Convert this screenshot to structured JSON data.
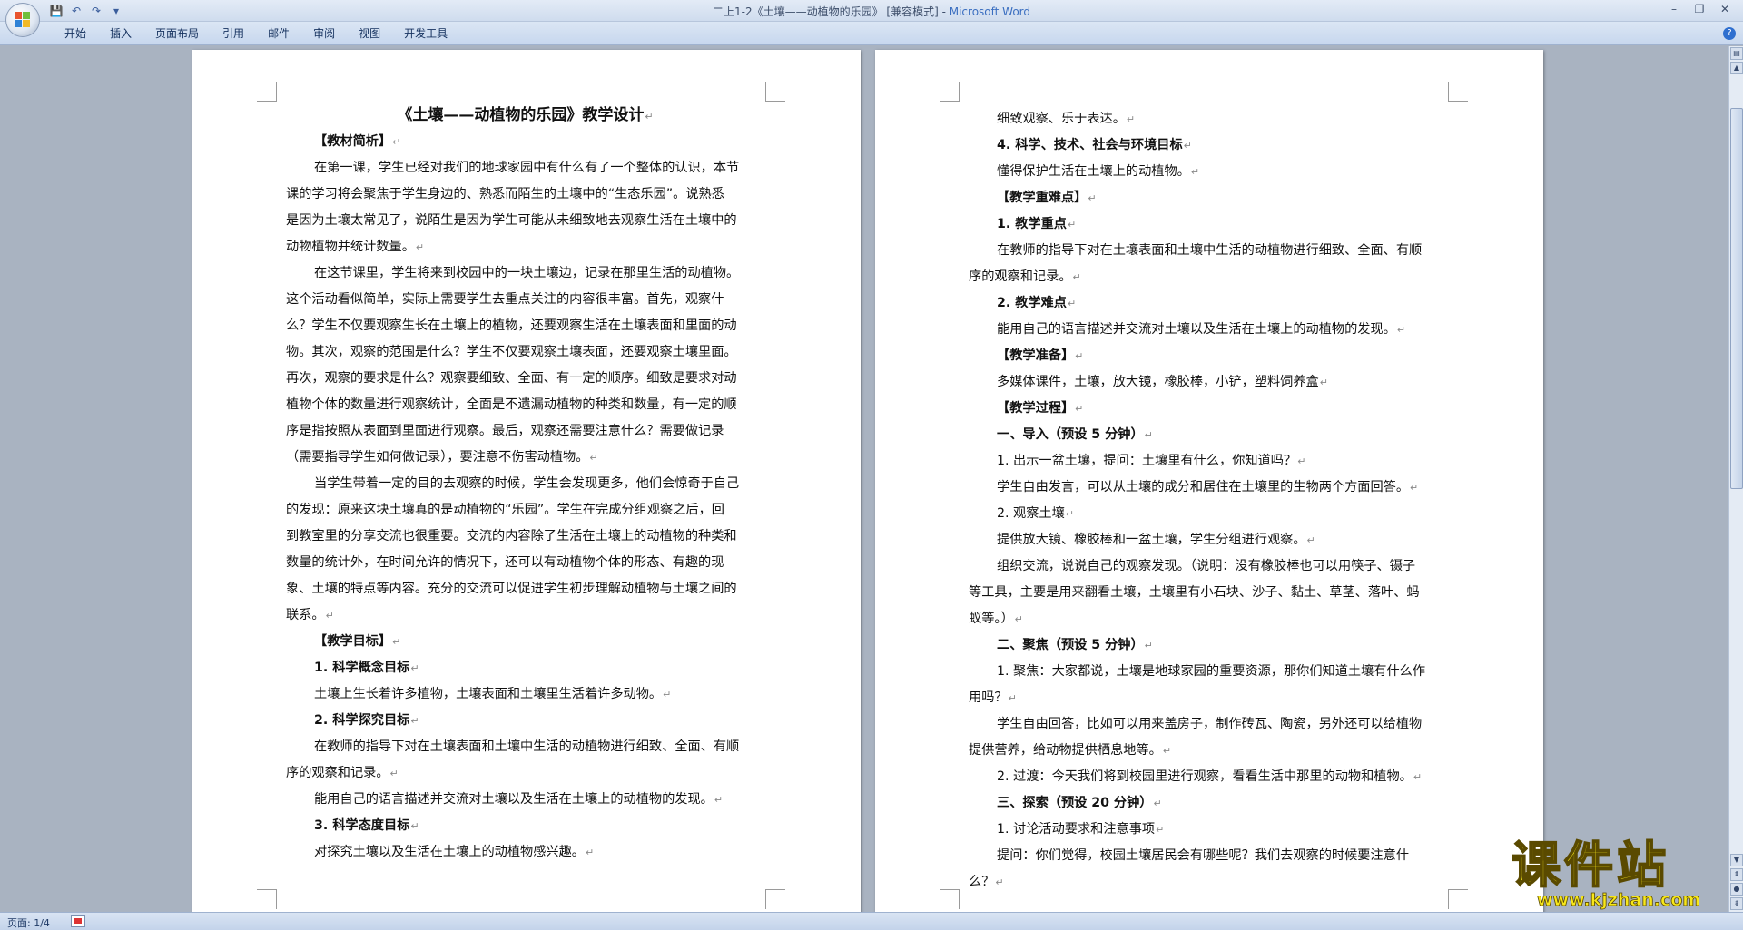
{
  "window": {
    "title": "二上1-2《土壤——动植物的乐园》 [兼容模式] - ",
    "app_name": "Microsoft Word"
  },
  "quick_access": {
    "save": "💾",
    "undo": "↶",
    "redo": "↷",
    "customize": "▾"
  },
  "ribbon_tabs": [
    "开始",
    "插入",
    "页面布局",
    "引用",
    "邮件",
    "审阅",
    "视图",
    "开发工具"
  ],
  "page1": {
    "title": "《土壤——动植物的乐园》教学设计",
    "lines": [
      {
        "text": "【教材简析】",
        "bold": true,
        "indent": true
      },
      {
        "text": "在第一课，学生已经对我们的地球家园中有什么有了一个整体的认识，本节",
        "indent": true,
        "nomark": true
      },
      {
        "text": "课的学习将会聚焦于学生身边的、熟悉而陌生的土壤中的“生态乐园”。说熟悉",
        "nomark": true
      },
      {
        "text": "是因为土壤太常见了，说陌生是因为学生可能从未细致地去观察生活在土壤中的",
        "nomark": true
      },
      {
        "text": "动物植物并统计数量。"
      },
      {
        "text": "在这节课里，学生将来到校园中的一块土壤边，记录在那里生活的动植物。",
        "indent": true,
        "nomark": true
      },
      {
        "text": "这个活动看似简单，实际上需要学生去重点关注的内容很丰富。首先，观察什",
        "nomark": true
      },
      {
        "text": "么？学生不仅要观察生长在土壤上的植物，还要观察生活在土壤表面和里面的动",
        "nomark": true
      },
      {
        "text": "物。其次，观察的范围是什么？学生不仅要观察土壤表面，还要观察土壤里面。",
        "nomark": true
      },
      {
        "text": "再次，观察的要求是什么？观察要细致、全面、有一定的顺序。细致是要求对动",
        "nomark": true
      },
      {
        "text": "植物个体的数量进行观察统计，全面是不遗漏动植物的种类和数量，有一定的顺",
        "nomark": true
      },
      {
        "text": "序是指按照从表面到里面进行观察。最后，观察还需要注意什么？需要做记录",
        "nomark": true
      },
      {
        "text": "（需要指导学生如何做记录），要注意不伤害动植物。"
      },
      {
        "text": "当学生带着一定的目的去观察的时候，学生会发现更多，他们会惊奇于自己",
        "indent": true,
        "nomark": true
      },
      {
        "text": "的发现：原来这块土壤真的是动植物的“乐园”。学生在完成分组观察之后，回",
        "nomark": true
      },
      {
        "text": "到教室里的分享交流也很重要。交流的内容除了生活在土壤上的动植物的种类和",
        "nomark": true
      },
      {
        "text": "数量的统计外，在时间允许的情况下，还可以有动植物个体的形态、有趣的现",
        "nomark": true
      },
      {
        "text": "象、土壤的特点等内容。充分的交流可以促进学生初步理解动植物与土壤之间的",
        "nomark": true
      },
      {
        "text": "联系。"
      },
      {
        "text": "【教学目标】",
        "bold": true,
        "indent": true
      },
      {
        "text": "1. 科学概念目标",
        "bold": true,
        "indent": true
      },
      {
        "text": "土壤上生长着许多植物，土壤表面和土壤里生活着许多动物。",
        "indent": true
      },
      {
        "text": "2. 科学探究目标",
        "bold": true,
        "indent": true
      },
      {
        "text": "在教师的指导下对在土壤表面和土壤中生活的动植物进行细致、全面、有顺",
        "indent": true,
        "nomark": true
      },
      {
        "text": "序的观察和记录。"
      },
      {
        "text": "能用自己的语言描述并交流对土壤以及生活在土壤上的动植物的发现。",
        "indent": true
      },
      {
        "text": "3. 科学态度目标",
        "bold": true,
        "indent": true
      },
      {
        "text": "对探究土壤以及生活在土壤上的动植物感兴趣。",
        "indent": true
      }
    ]
  },
  "page2": {
    "lines": [
      {
        "text": "细致观察、乐于表达。",
        "indent": true
      },
      {
        "text": "4. 科学、技术、社会与环境目标",
        "bold": true,
        "indent": true
      },
      {
        "text": "懂得保护生活在土壤上的动植物。",
        "indent": true
      },
      {
        "text": "【教学重难点】",
        "bold": true,
        "indent": true
      },
      {
        "text": "1. 教学重点",
        "bold": true,
        "indent": true
      },
      {
        "text": "在教师的指导下对在土壤表面和土壤中生活的动植物进行细致、全面、有顺",
        "indent": true,
        "nomark": true
      },
      {
        "text": "序的观察和记录。"
      },
      {
        "text": "2. 教学难点",
        "bold": true,
        "indent": true
      },
      {
        "text": "能用自己的语言描述并交流对土壤以及生活在土壤上的动植物的发现。",
        "indent": true
      },
      {
        "text": "【教学准备】",
        "bold": true,
        "indent": true
      },
      {
        "text": "多媒体课件，土壤，放大镜，橡胶棒，小铲，塑料饲养盒",
        "indent": true
      },
      {
        "text": "【教学过程】",
        "bold": true,
        "indent": true
      },
      {
        "text": "一、导入（预设 5 分钟）",
        "bold": true,
        "indent": true
      },
      {
        "text": "1. 出示一盆土壤，提问：土壤里有什么，你知道吗？",
        "indent": true
      },
      {
        "text": "学生自由发言，可以从土壤的成分和居住在土壤里的生物两个方面回答。",
        "indent": true
      },
      {
        "text": "2. 观察土壤",
        "indent": true
      },
      {
        "text": "提供放大镜、橡胶棒和一盆土壤，学生分组进行观察。",
        "indent": true
      },
      {
        "text": "组织交流，说说自己的观察发现。（说明：没有橡胶棒也可以用筷子、镊子",
        "indent": true,
        "nomark": true
      },
      {
        "text": "等工具，主要是用来翻看土壤，土壤里有小石块、沙子、黏土、草茎、落叶、蚂",
        "nomark": true
      },
      {
        "text": "蚁等。）"
      },
      {
        "text": "二、聚焦（预设 5 分钟）",
        "bold": true,
        "indent": true
      },
      {
        "text": "1. 聚焦：大家都说，土壤是地球家园的重要资源，那你们知道土壤有什么作",
        "indent": true,
        "nomark": true
      },
      {
        "text": "用吗？"
      },
      {
        "text": "学生自由回答，比如可以用来盖房子，制作砖瓦、陶瓷，另外还可以给植物",
        "indent": true,
        "nomark": true
      },
      {
        "text": "提供营养，给动物提供栖息地等。"
      },
      {
        "text": "2. 过渡：今天我们将到校园里进行观察，看看生活中那里的动物和植物。",
        "indent": true
      },
      {
        "text": "三、探索（预设 20 分钟）",
        "bold": true,
        "indent": true
      },
      {
        "text": "1. 讨论活动要求和注意事项",
        "indent": true
      },
      {
        "text": "提问：你们觉得，校园土壤居民会有哪些呢？我们去观察的时候要注意什",
        "indent": true,
        "nomark": true
      },
      {
        "text": "么？"
      }
    ]
  },
  "paragraph_mark": "↵",
  "status": {
    "page": "页面: 1/4"
  },
  "watermark": {
    "name": "课件站",
    "url": "www.kjzhan.com"
  },
  "colors": {
    "workspace": "#a9b3c1",
    "ribbon": "#c7d7ee",
    "title_app": "#3a6ec0",
    "watermark_yellow": "#f7e71a"
  }
}
